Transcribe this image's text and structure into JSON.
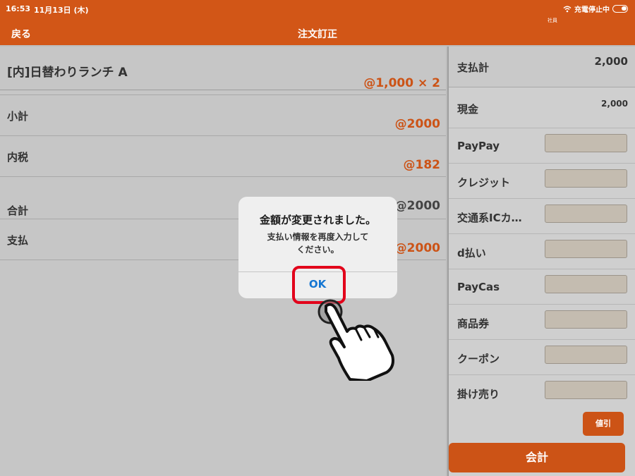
{
  "status_bar": {
    "time": "16:53",
    "date": "11月13日 (木)",
    "charging": "充電停止中",
    "staff": "社員"
  },
  "nav": {
    "back_label": "戻る",
    "title": "注文訂正"
  },
  "order": {
    "item_name": "[内]日替わりランチ A",
    "item_price": "@1,000 × 2"
  },
  "summary": {
    "subtotal_label": "小計",
    "subtotal_value": "@2000",
    "tax_label": "内税",
    "tax_value": "@182",
    "total_label": "合計",
    "total_value": "@2000",
    "paid_label": "支払",
    "paid_value": "@2000"
  },
  "payment": {
    "total_label": "支払計",
    "total_value": "2,000",
    "cash_label": "現金",
    "cash_value": "2,000",
    "methods": [
      "PayPay",
      "クレジット",
      "交通系ICカ…",
      "d払い",
      "PayCas",
      "商品券",
      "クーポン",
      "掛け売り"
    ],
    "discount_label": "値引",
    "checkout_label": "会計"
  },
  "dialog": {
    "title": "金額が変更されました。",
    "message": "支払い情報を再度入力して\nください。",
    "ok_label": "OK"
  },
  "colors": {
    "accent": "#d25617",
    "highlight": "#e2001a",
    "link": "#1576d2"
  }
}
